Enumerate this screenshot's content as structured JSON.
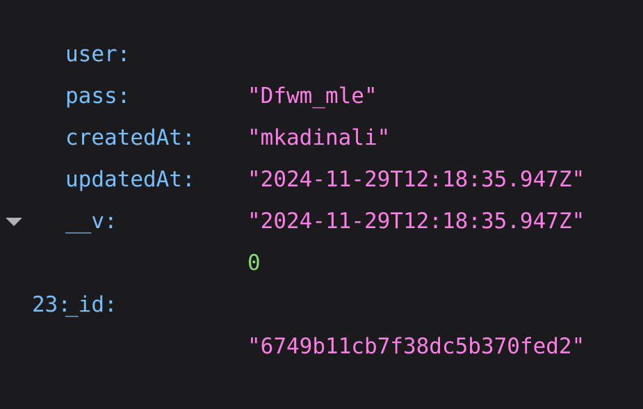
{
  "rows": [
    {
      "key": "user:",
      "value": "\"Dfwm_mle\"",
      "type": "string"
    },
    {
      "key": "pass:",
      "value": "\"mkadinali\"",
      "type": "string"
    },
    {
      "key": "createdAt:",
      "value": "\"2024-11-29T12:18:35.947Z\"",
      "type": "string"
    },
    {
      "key": "updatedAt:",
      "value": "\"2024-11-29T12:18:35.947Z\"",
      "type": "string"
    },
    {
      "key": "__v:",
      "value": "0",
      "type": "number"
    }
  ],
  "group": {
    "index": "23:",
    "expanded": true
  },
  "child_rows": [
    {
      "key": "_id:",
      "value": "\"6749b11cb7f38dc5b370fed2\"",
      "type": "string"
    }
  ],
  "colors": {
    "background": "#1b1b1d",
    "key": "#75bfff",
    "string": "#ff7de9",
    "number": "#86de74",
    "twisty": "#b1b1b3"
  },
  "icons": {
    "expand": "triangle-down-icon"
  }
}
